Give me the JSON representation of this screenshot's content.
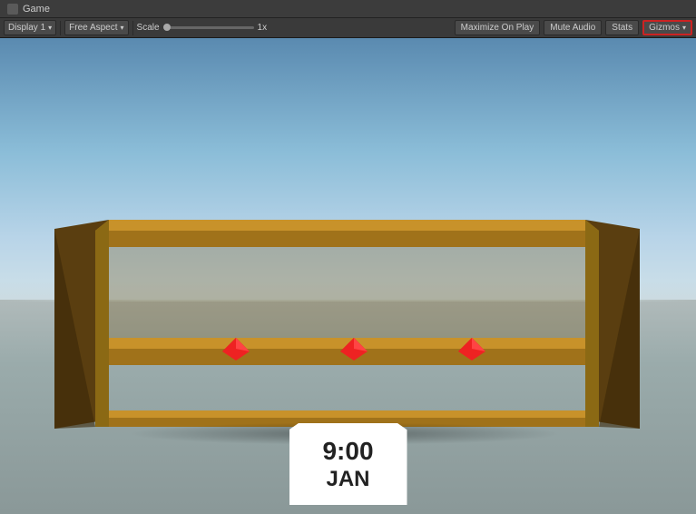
{
  "window": {
    "title": "Game",
    "icon": "game-icon"
  },
  "toolbar": {
    "display_label": "Display 1",
    "aspect_label": "Free Aspect",
    "scale_label": "Scale",
    "scale_value": "1x",
    "maximize_label": "Maximize On Play",
    "mute_label": "Mute Audio",
    "stats_label": "Stats",
    "gizmos_label": "Gizmos"
  },
  "scene": {
    "sign": {
      "time": "9:00",
      "month": "JAN"
    }
  },
  "colors": {
    "gizmos_border": "#cc2222",
    "sky_top": "#5a8ab0",
    "sky_bottom": "#c8dde8",
    "shelf_wood": "#8B6914",
    "shelf_dark": "#6B4F10"
  }
}
